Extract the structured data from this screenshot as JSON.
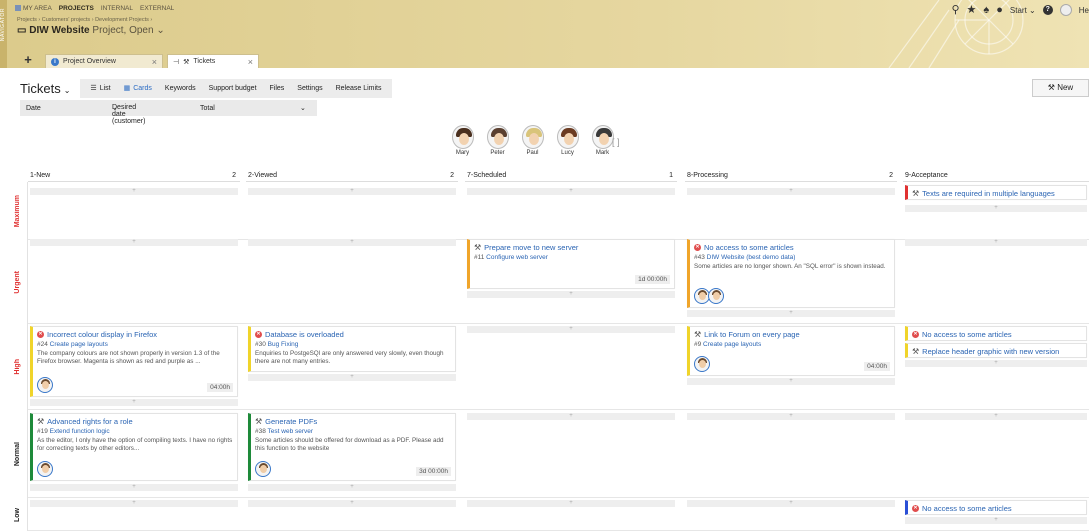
{
  "nav": {
    "strip_label": "NAVIGATOR",
    "menu": [
      "MY AREA",
      "PROJECTS",
      "INTERNAL",
      "EXTERNAL"
    ],
    "active_menu": "PROJECTS"
  },
  "breadcrumb": "Projects › Customers' projects › Development Projects ›",
  "project": {
    "name": "DIW Website",
    "status": "Project, Open"
  },
  "tabs": [
    {
      "label": "Project Overview"
    },
    {
      "label": "Tickets"
    }
  ],
  "topright": {
    "start_label": "Start",
    "user_fragment": "He"
  },
  "page": {
    "title": "Tickets"
  },
  "views": [
    "List",
    "Cards",
    "Keywords",
    "Support budget",
    "Files",
    "Settings",
    "Release Limits"
  ],
  "active_view": "Cards",
  "new_button": "New",
  "filters": {
    "date": "Date",
    "desired": "Desired date (customer)",
    "total": "Total"
  },
  "people": [
    "Mary",
    "Peter",
    "Paul",
    "Lucy",
    "Mark"
  ],
  "columns": [
    {
      "name": "1-New",
      "count": "2"
    },
    {
      "name": "2-Viewed",
      "count": "2"
    },
    {
      "name": "7-Scheduled",
      "count": "1"
    },
    {
      "name": "8-Processing",
      "count": "2"
    },
    {
      "name": "9-Acceptance",
      "count": ""
    }
  ],
  "lanes": [
    {
      "name": "Maximum",
      "color": "#e03131"
    },
    {
      "name": "Urgent",
      "color": "#e03131"
    },
    {
      "name": "High",
      "color": "#e03131"
    },
    {
      "name": "Normal",
      "color": "#222222"
    },
    {
      "name": "Low",
      "color": "#222222"
    }
  ],
  "add_symbol": "+",
  "cards": {
    "c1": {
      "title": "Texts are required in multiple languages"
    },
    "c2": {
      "title": "Prepare move to new server",
      "num": "#11",
      "parent": "Configure web server",
      "time": "1d 00:00h"
    },
    "c3": {
      "title": "No access to some articles",
      "num": "#43",
      "parent": "DIW Website (best demo data)",
      "desc": "Some articles are no longer shown. An \"SQL error\" is shown instead."
    },
    "c4": {
      "title": "Incorrect colour display in Firefox",
      "num": "#24",
      "parent": "Create page layouts",
      "desc": "The company colours are not shown properly in version 1.3 of the Firefox browser. Magenta is shown as red and purple as ...",
      "time": "04:00h"
    },
    "c5": {
      "title": "Database is overloaded",
      "num": "#30",
      "parent": "Bug Fixing",
      "desc": "Enquiries to PostgeSQl are only answered very slowly, even though there are not many entries."
    },
    "c6": {
      "title": "Link to Forum on every page",
      "num": "#9",
      "parent": "Create page layouts",
      "time": "04:00h"
    },
    "c7": {
      "title": "No access to some articles"
    },
    "c8": {
      "title": "Replace header graphic with new version"
    },
    "c9": {
      "title": "Advanced rights for a role",
      "num": "#19",
      "parent": "Extend function logic",
      "desc": "As the editor, I only have the option of compiling texts. I have no rights for correcting texts by other editors..."
    },
    "c10": {
      "title": "Generate PDFs",
      "num": "#38",
      "parent": "Test web server",
      "desc": "Some articles should be offered for download as a PDF. Please add this function to the website",
      "time": "3d 00:00h"
    },
    "c11": {
      "title": "No access to some articles"
    }
  }
}
